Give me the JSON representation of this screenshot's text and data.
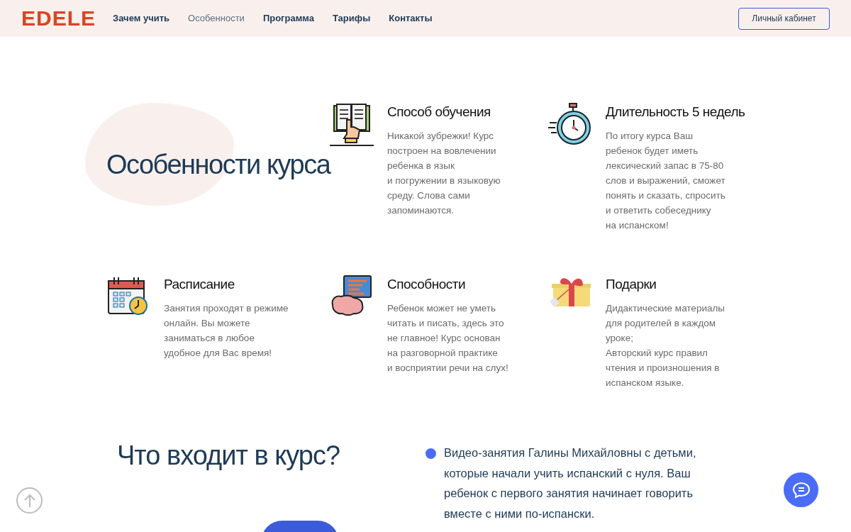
{
  "header": {
    "logo": "EDELE",
    "nav": [
      {
        "label": "Зачем учить",
        "selected": false
      },
      {
        "label": "Особенности",
        "selected": true
      },
      {
        "label": "Программа",
        "selected": false
      },
      {
        "label": "Тарифы",
        "selected": false
      },
      {
        "label": "Контакты",
        "selected": false
      }
    ],
    "account_button": "Личный кабинет"
  },
  "features_section": {
    "title": "Особенности курса",
    "features": [
      {
        "kind": "book",
        "title": "Способ обучения",
        "text": "Никакой зубрежки! Курс\nпостроен на вовлечении\nребенка в язык\nи погружении в языковую\nсреду. Слова сами\nзапоминаются."
      },
      {
        "kind": "stopwatch",
        "title": "Длительность 5 недель",
        "text": "По итогу курса Ваш\nребенок будет иметь\nлексический запас в 75-80\nслов и выражений, сможет\nпонять и сказать, спросить\nи ответить собеседнику\nна испанском!"
      },
      {
        "kind": "calendar",
        "title": "Расписание",
        "text": "Занятия проходят в режиме\nонлайн. Вы можете\nзаниматься в любое\nудобное для Вас время!"
      },
      {
        "kind": "brain",
        "title": "Способности",
        "text": "Ребенок может не уметь\nчитать и писать, здесь это\nне главное! Курс основан\nна разговорной практике\nи восприятии речи на слух!"
      },
      {
        "kind": "gift",
        "title": "Подарки",
        "text": "Дидактические материалы\nдля родителей в каждом\nуроке;\nАвторский курс правил\nчтения и произношения в\nиспанском языке."
      }
    ]
  },
  "includes_section": {
    "title": "Что входит в курс?",
    "items": [
      "Видео-занятия Галины Михайловны с детьми,\nкоторые начали учить испанский с нуля. Ваш\nребенок с первого занятия начинает говорить\nвместе с ними по-испански."
    ]
  }
}
